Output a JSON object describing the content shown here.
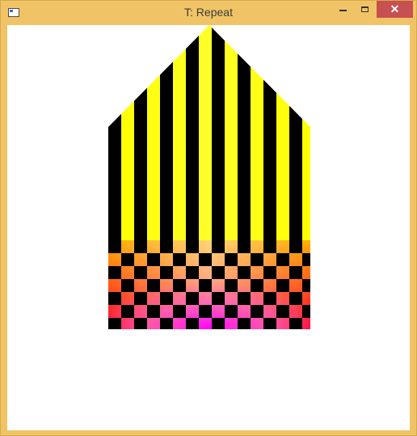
{
  "window": {
    "title": "T: Repeat",
    "close_glyph": "✕"
  },
  "icons": {
    "app": "app-window-icon",
    "minimize": "minimize-icon",
    "maximize": "maximize-icon",
    "close": "close-icon"
  },
  "colors": {
    "frame": "#f0c466",
    "close_button": "#c75050",
    "stripe_yellow": "#ffff00",
    "stripe_pale": "#ffffd0",
    "stripe_black": "#000000",
    "checker_top": "#ffb000",
    "checker_bottom": "#ff0000",
    "checker_center": "#ff00ff"
  }
}
